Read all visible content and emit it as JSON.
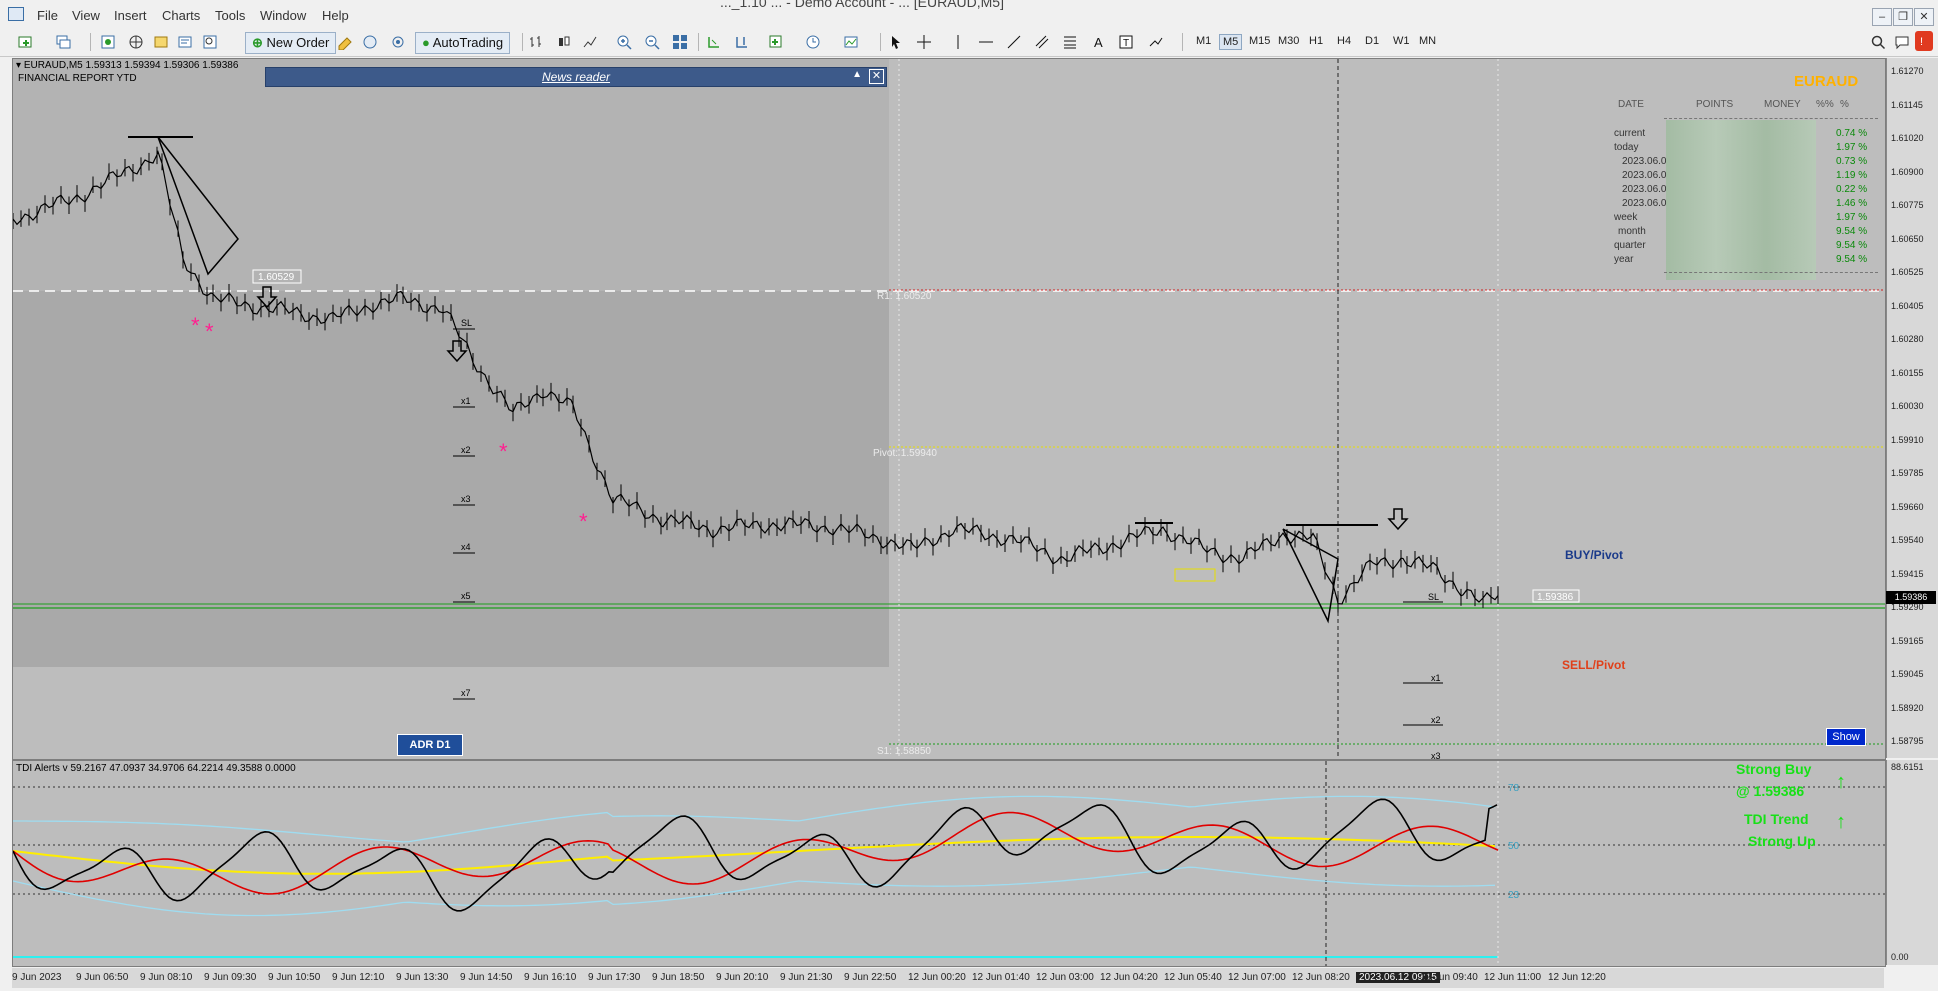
{
  "window": {
    "title": "..._1.10 ... - Demo Account - ... [EURAUD,M5]",
    "menu": [
      "File",
      "View",
      "Insert",
      "Charts",
      "Tools",
      "Window",
      "Help"
    ]
  },
  "toolbar": {
    "new_order": "New Order",
    "autotrading": "AutoTrading",
    "timeframes": [
      "M1",
      "M5",
      "M15",
      "M30",
      "H1",
      "H4",
      "D1",
      "W1",
      "MN"
    ],
    "active_timeframe": "M5"
  },
  "chart": {
    "symbol_info": "EURAUD,M5 1.59313 1.59394 1.59306 1.59386",
    "report_title": "FINANCIAL REPORT YTD",
    "news_reader": "News reader",
    "pair_name": "EURAUD",
    "buy_pivot": "BUY/Pivot",
    "sell_pivot": "SELL/Pivot",
    "show_label": "Show",
    "adr_label": "ADR D1",
    "r1_label": "R1: 1.60520",
    "pivot_label": "Pivot: 1.59940",
    "s1_label": "S1: 1.58850",
    "high_label": "1.60529",
    "current_price": "1.59386",
    "price_tag_right": "1.59386",
    "trade_levels": [
      "SL",
      "x1",
      "x2",
      "x3",
      "x4",
      "x5",
      "x7"
    ],
    "trade_levels_right": [
      "SL",
      "x1",
      "x2",
      "x3"
    ]
  },
  "price_axis": [
    "1.61270",
    "1.61145",
    "1.61020",
    "1.60900",
    "1.60775",
    "1.60650",
    "1.60525",
    "1.60405",
    "1.60280",
    "1.60155",
    "1.60030",
    "1.59910",
    "1.59785",
    "1.59660",
    "1.59540",
    "1.59415",
    "1.59290",
    "1.59165",
    "1.59045",
    "1.58920",
    "1.58795"
  ],
  "report": {
    "headers": [
      "DATE",
      "POINTS",
      "MONEY",
      "%%",
      "%"
    ],
    "rows": [
      {
        "label": "current",
        "value": "0.74  %"
      },
      {
        "label": "today",
        "value": "1.97  %"
      },
      {
        "label": "2023.06.0",
        "value": "0.73  %"
      },
      {
        "label": "2023.06.0",
        "value": "1.19  %"
      },
      {
        "label": "2023.06.0",
        "value": "0.22  %"
      },
      {
        "label": "2023.06.0",
        "value": "1.46  %"
      },
      {
        "label": "week",
        "value": "1.97  %"
      },
      {
        "label": "month",
        "value": "9.54  %"
      },
      {
        "label": "quarter",
        "value": "9.54  %"
      },
      {
        "label": "year",
        "value": "9.54  %"
      }
    ]
  },
  "tdi": {
    "label": "TDI Alerts v 59.2167 47.0937 34.9706 64.2214 49.3588 0.0000",
    "levels": [
      "78",
      "50",
      "23"
    ],
    "axis_top": "88.6151",
    "axis_bottom": "0.00",
    "strong_buy": "Strong Buy",
    "strong_buy_price": "@ 1.59386",
    "trend_title": "TDI Trend",
    "trend_value": "Strong Up"
  },
  "time_axis": [
    "9 Jun 2023",
    "9 Jun 06:50",
    "9 Jun 08:10",
    "9 Jun 09:30",
    "9 Jun 10:50",
    "9 Jun 12:10",
    "9 Jun 13:30",
    "9 Jun 14:50",
    "9 Jun 16:10",
    "9 Jun 17:30",
    "9 Jun 18:50",
    "9 Jun 20:10",
    "9 Jun 21:30",
    "9 Jun 22:50",
    "12 Jun 00:20",
    "12 Jun 01:40",
    "12 Jun 03:00",
    "12 Jun 04:20",
    "12 Jun 05:40",
    "12 Jun 07:00",
    "12 Jun 08:20",
    "2023.06.12 09:15",
    "12 Jun 09:40",
    "12 Jun 11:00",
    "12 Jun 12:20"
  ],
  "crosshair_time": "2023.06.12 09:15",
  "colors": {
    "chart_bg": "#bdbdbd",
    "tdi_red": "#e00000",
    "tdi_yellow": "#ffee00",
    "tdi_band": "#9fdcf0",
    "signal_green": "#17e017",
    "pair_gold": "#ffb100"
  }
}
